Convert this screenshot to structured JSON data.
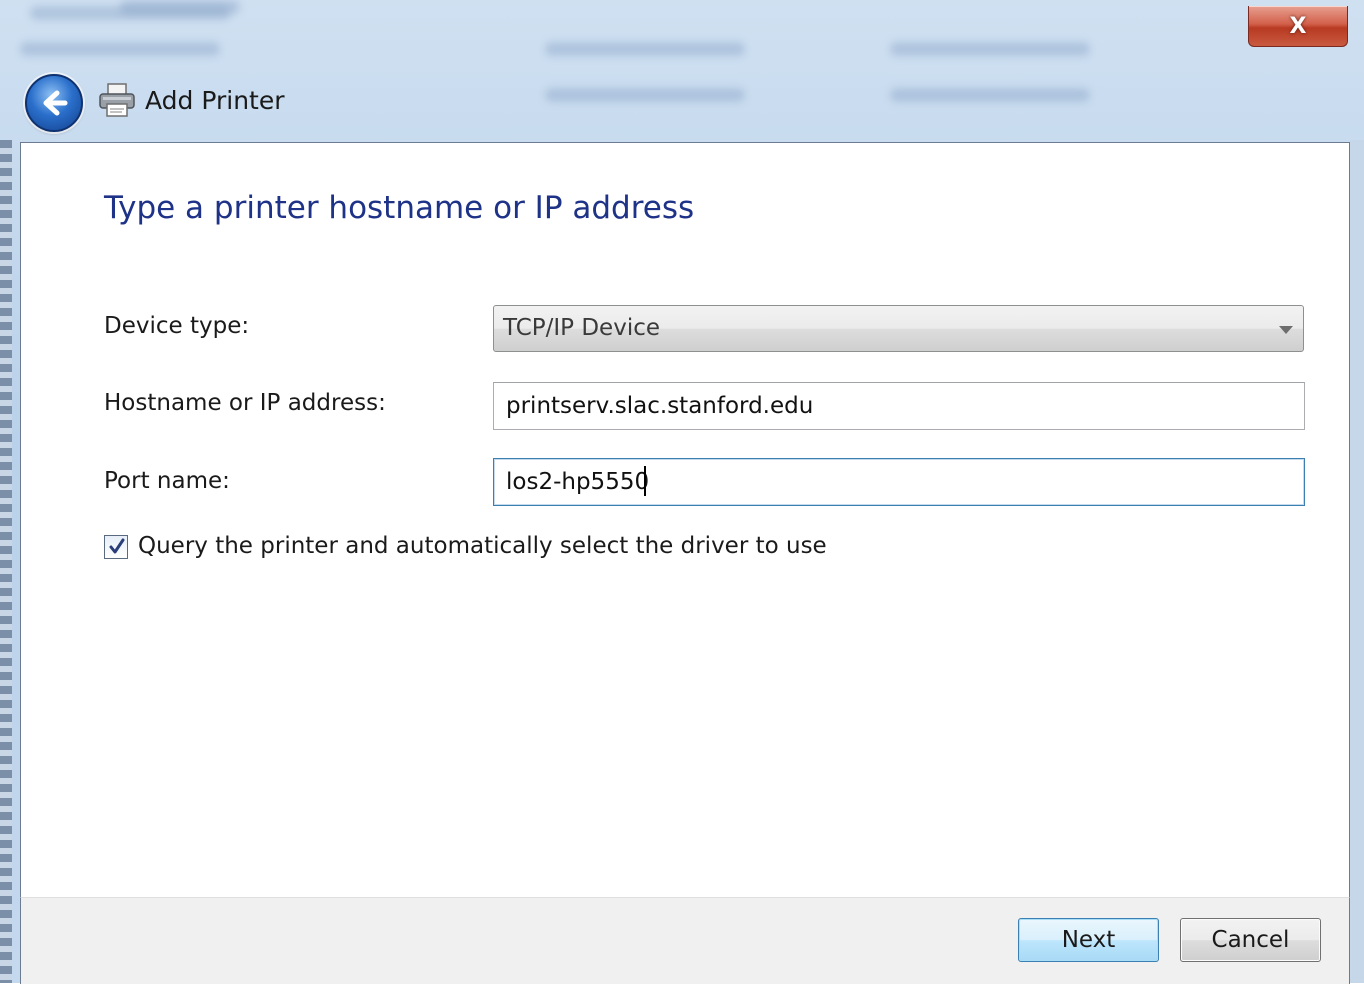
{
  "window": {
    "title": "Add Printer",
    "close_glyph": "X"
  },
  "page": {
    "heading": "Type a printer hostname or IP address"
  },
  "form": {
    "device_type_label": "Device type:",
    "device_type_value": "TCP/IP Device",
    "hostname_label": "Hostname or IP address:",
    "hostname_value": "printserv.slac.stanford.edu",
    "port_label": "Port name:",
    "port_value": "los2-hp5550",
    "query_label": "Query the printer and automatically select the driver to use",
    "query_checked": true
  },
  "buttons": {
    "next_label": "Next",
    "cancel_label": "Cancel"
  },
  "icons": {
    "back": "back-arrow-icon",
    "printer": "printer-icon",
    "close": "close-icon",
    "dropdown": "chevron-down-icon",
    "check": "checkmark-icon"
  },
  "colors": {
    "heading": "#1e3287",
    "close_button": "#c85a40",
    "next_border": "#3c7fb1"
  }
}
